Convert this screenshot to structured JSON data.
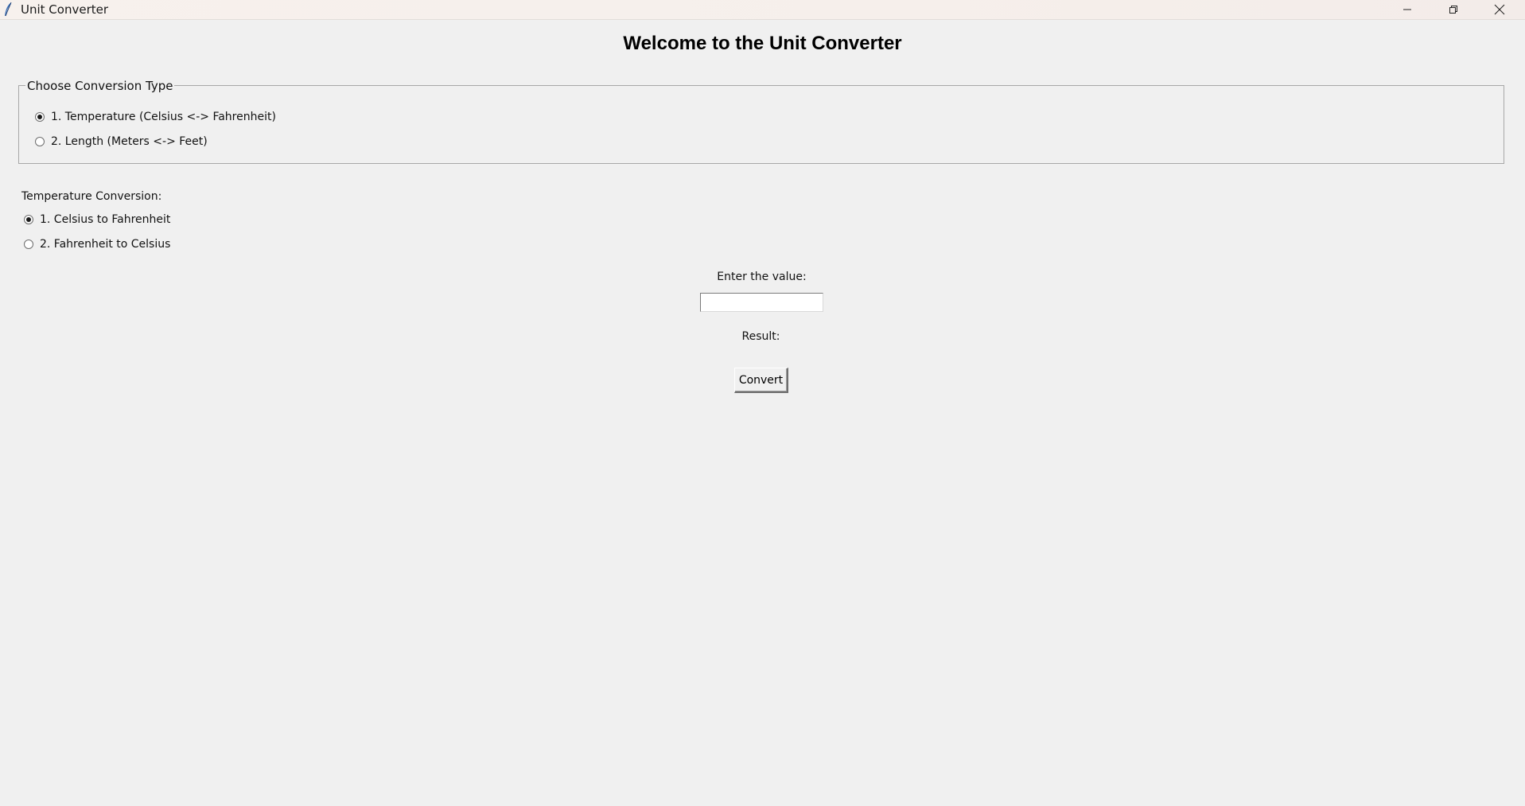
{
  "window": {
    "title": "Unit Converter"
  },
  "heading": "Welcome to the Unit Converter",
  "conversion_type": {
    "legend": "Choose Conversion Type",
    "options": [
      {
        "label": "1. Temperature (Celsius <-> Fahrenheit)",
        "checked": true
      },
      {
        "label": "2. Length (Meters <-> Feet)",
        "checked": false
      }
    ]
  },
  "temperature": {
    "heading": "Temperature Conversion:",
    "options": [
      {
        "label": "1. Celsius to Fahrenheit",
        "checked": true
      },
      {
        "label": "2. Fahrenheit to Celsius",
        "checked": false
      }
    ]
  },
  "input": {
    "label": "Enter the value:",
    "value": "",
    "placeholder": ""
  },
  "result": {
    "label": "Result:"
  },
  "convert_button": {
    "label": "Convert"
  }
}
